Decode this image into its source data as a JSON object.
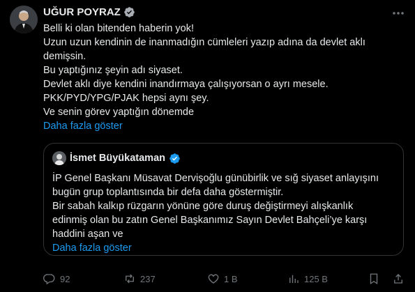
{
  "post": {
    "author_name": "UĞUR POYRAZ",
    "body_lines": [
      "Belli ki olan bitenden haberin yok!",
      "Uzun uzun kendinin de inanmadığın cümleleri yazıp adına da devlet aklı",
      "demişsin.",
      "Bu yaptığınız şeyin adı siyaset.",
      "Devlet aklı diye kendini inandırmaya çalışıyorsan o ayrı mesele.",
      "PKK/PYD/YPG/PJAK hepsi aynı şey.",
      "Ve senin görev yaptığın dönemde"
    ],
    "show_more": "Daha fazla göster"
  },
  "quote": {
    "author_name": "İsmet Büyükataman",
    "body_lines": [
      "İP Genel Başkanı Müsavat Dervişoğlu günübirlik ve sığ siyaset anlayışını",
      "bugün grup toplantısında bir defa daha göstermiştir.",
      "Bir sabah kalkıp rüzgarın yönüne göre duruş değiştirmeyi alışkanlık",
      "edinmiş olan bu zatın Genel Başkanımız Sayın Devlet Bahçeli’ye karşı",
      "haddini aşan ve"
    ],
    "show_more": "Daha fazla göster"
  },
  "actions": {
    "replies": "92",
    "reposts": "237",
    "likes": "1 B",
    "views": "125 B"
  },
  "colors": {
    "background": "#000000",
    "text": "#e7e9ea",
    "muted": "#71767b",
    "link": "#1d9bf0",
    "border": "#2f3336"
  }
}
